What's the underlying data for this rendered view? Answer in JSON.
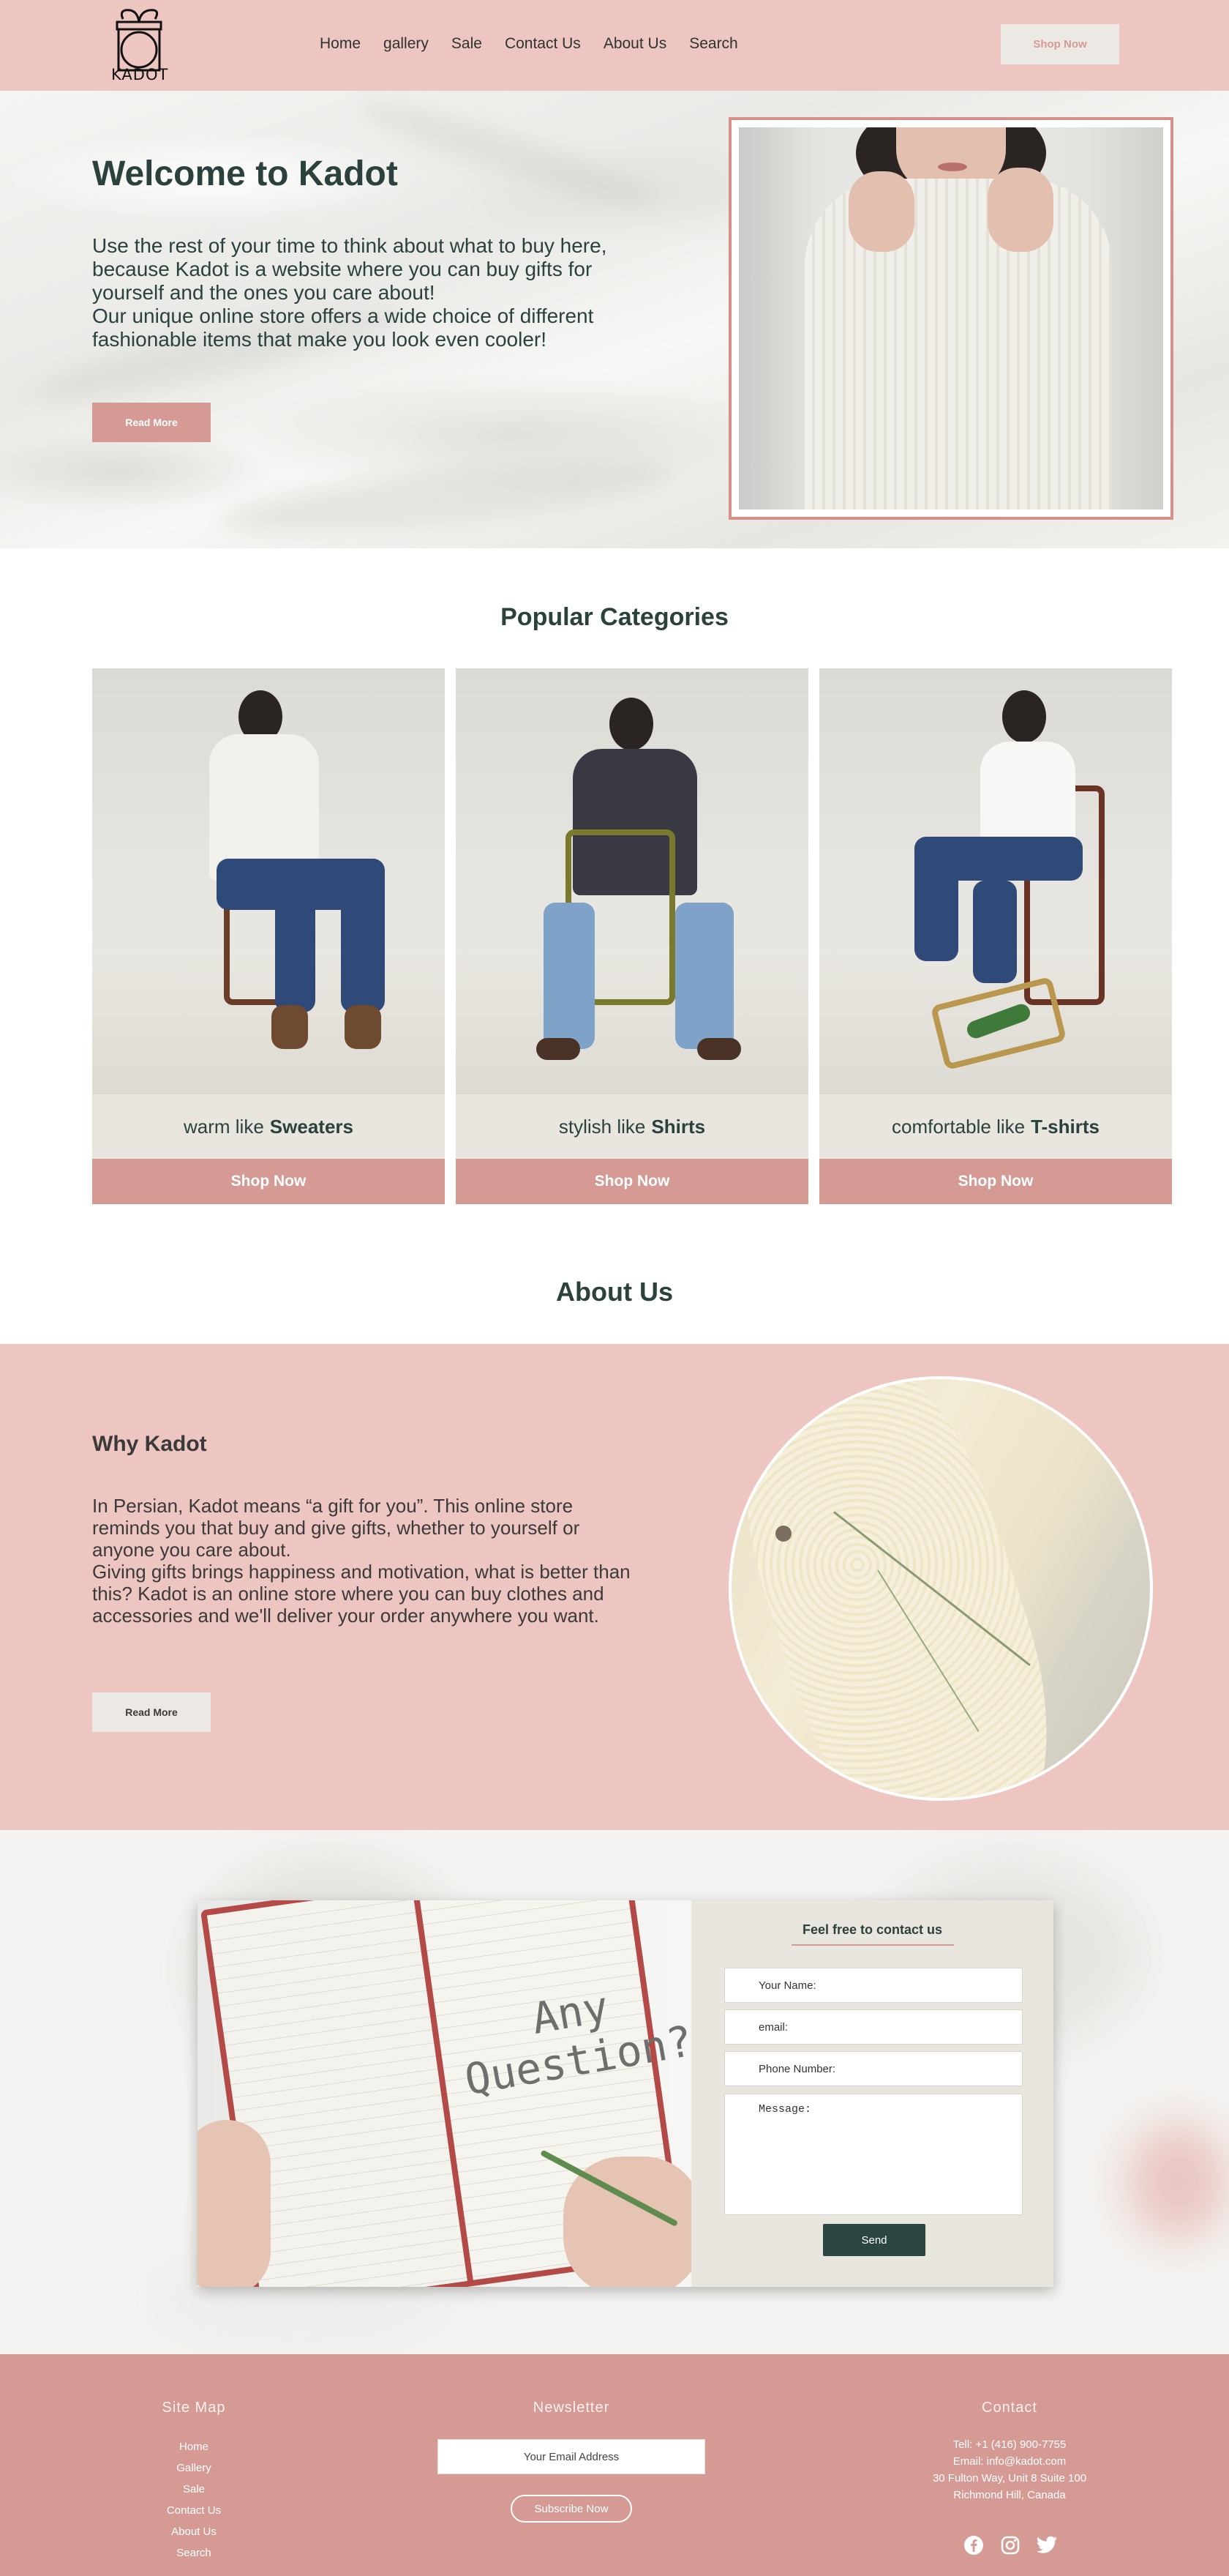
{
  "header": {
    "logo_text": "KADOT",
    "nav": [
      "Home",
      "gallery",
      "Sale",
      "Contact Us",
      "About Us",
      "Search"
    ],
    "shop_now": "Shop Now"
  },
  "hero": {
    "title": "Welcome to Kadot",
    "paragraph_1": "Use the rest of your time to think about what to buy here, because Kadot is a website where you can buy gifts for yourself and the ones you care about!",
    "paragraph_2": "Our unique online store offers a wide choice of different fashionable items that make you look even cooler!",
    "read_more": "Read More"
  },
  "categories": {
    "title": "Popular Categories",
    "items": [
      {
        "prefix": "warm like",
        "name": "Sweaters",
        "button": "Shop Now"
      },
      {
        "prefix": "stylish like",
        "name": "Shirts",
        "button": "Shop Now"
      },
      {
        "prefix": "comfortable like",
        "name": "T-shirts",
        "button": "Shop Now"
      }
    ]
  },
  "about": {
    "title": "About Us",
    "heading": "Why Kadot",
    "paragraph_1": "In Persian, Kadot means “a gift for you”. This online store reminds you that buy and give gifts, whether to yourself or anyone you care about.",
    "paragraph_2": "Giving gifts brings happiness and motivation, what is better than this? Kadot is an online store where you can buy clothes and accessories and we'll deliver your order anywhere you want.",
    "read_more": "Read More"
  },
  "contact_form": {
    "image_text_1": "Any",
    "image_text_2": "Question?",
    "title": "Feel free to contact us",
    "name_placeholder": "Your Name:",
    "email_placeholder": "email:",
    "phone_placeholder": "Phone Number:",
    "message_placeholder": "Message:",
    "send": "Send"
  },
  "footer": {
    "site_map_title": "Site Map",
    "site_map": [
      "Home",
      "Gallery",
      "Sale",
      "Contact Us",
      "About Us",
      "Search"
    ],
    "newsletter_title": "Newsletter",
    "email_placeholder": "Your Email Address",
    "subscribe": "Subscribe Now",
    "contact_title": "Contact",
    "tell": "Tell: +1 (416) 900-7755",
    "email": "Email: info@kadot.com",
    "address_1": "30 Fulton Way, Unit 8 Suite 100",
    "address_2": "Richmond Hill, Canada",
    "socials": [
      "facebook-icon",
      "instagram-icon",
      "twitter-icon"
    ]
  },
  "colors": {
    "header_bg": "#eec6c1",
    "accent": "#d59a94",
    "dark": "#2b413d",
    "light_button": "#ece9e4"
  }
}
